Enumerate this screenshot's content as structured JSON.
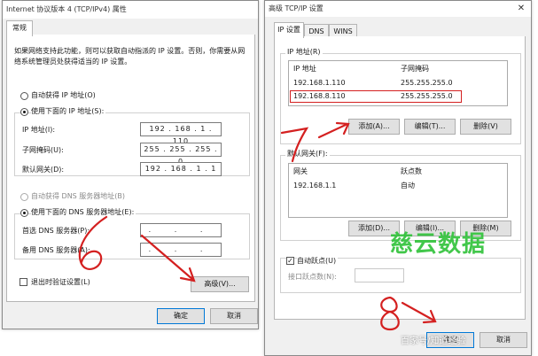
{
  "left_dialog": {
    "title": "Internet 协议版本 4 (TCP/IPv4) 属性",
    "tab_general": "常规",
    "description_line1": "如果网络支持此功能，则可以获取自动指派的 IP 设置。否则，你需要从网",
    "description_line2": "络系统管理员处获得适当的 IP 设置。",
    "auto_ip_label": "自动获得 IP 地址(O)",
    "manual_ip_label": "使用下面的 IP 地址(S):",
    "ip_label": "IP 地址(I):",
    "ip_value": "192 . 168 . 1 . 110",
    "mask_label": "子网掩码(U):",
    "mask_value": "255 . 255 . 255 . 0",
    "gateway_label": "默认网关(D):",
    "gateway_value": "192 . 168 . 1 . 1",
    "auto_dns_label": "自动获得 DNS 服务器地址(B)",
    "manual_dns_label": "使用下面的 DNS 服务器地址(E):",
    "preferred_dns_label": "首选 DNS 服务器(P):",
    "preferred_dns_value": ". . .",
    "alternate_dns_label": "备用 DNS 服务器(A):",
    "alternate_dns_value": ". . .",
    "validate_label": "退出时验证设置(L)",
    "advanced_button": "高级(V)...",
    "ok_button": "确定",
    "cancel_button": "取消"
  },
  "right_dialog": {
    "title": "高级 TCP/IP 设置",
    "tabs": [
      "IP 设置",
      "DNS",
      "WINS"
    ],
    "ip_group_title": "IP 地址(R)",
    "ip_col_header": "IP 地址",
    "mask_col_header": "子网掩码",
    "ip_rows": [
      {
        "ip": "192.168.1.110",
        "mask": "255.255.255.0"
      },
      {
        "ip": "192.168.8.110",
        "mask": "255.255.255.0"
      }
    ],
    "add_button": "添加(A)...",
    "edit_button": "编辑(T)...",
    "delete_button": "删除(V)",
    "gateway_group_title": "默认网关(F):",
    "gateway_col_header": "网关",
    "metric_col_header": "跃点数",
    "gateway_rows": [
      {
        "gateway": "192.168.1.1",
        "metric": "自动"
      }
    ],
    "add_button2": "添加(D)...",
    "edit_button2": "编辑(I)...",
    "delete_button2": "删除(M)",
    "auto_metric_label": "自动跃点(U)",
    "interface_metric_label": "接口跃点数(N):",
    "ok_button": "确定",
    "cancel_button": "取消"
  },
  "annotations": {
    "step6": "6",
    "step7": "7",
    "step8": "8",
    "accent_color": "#d42020"
  },
  "watermark": {
    "main": "慈云数据",
    "footer": "百家号/知道经验"
  }
}
